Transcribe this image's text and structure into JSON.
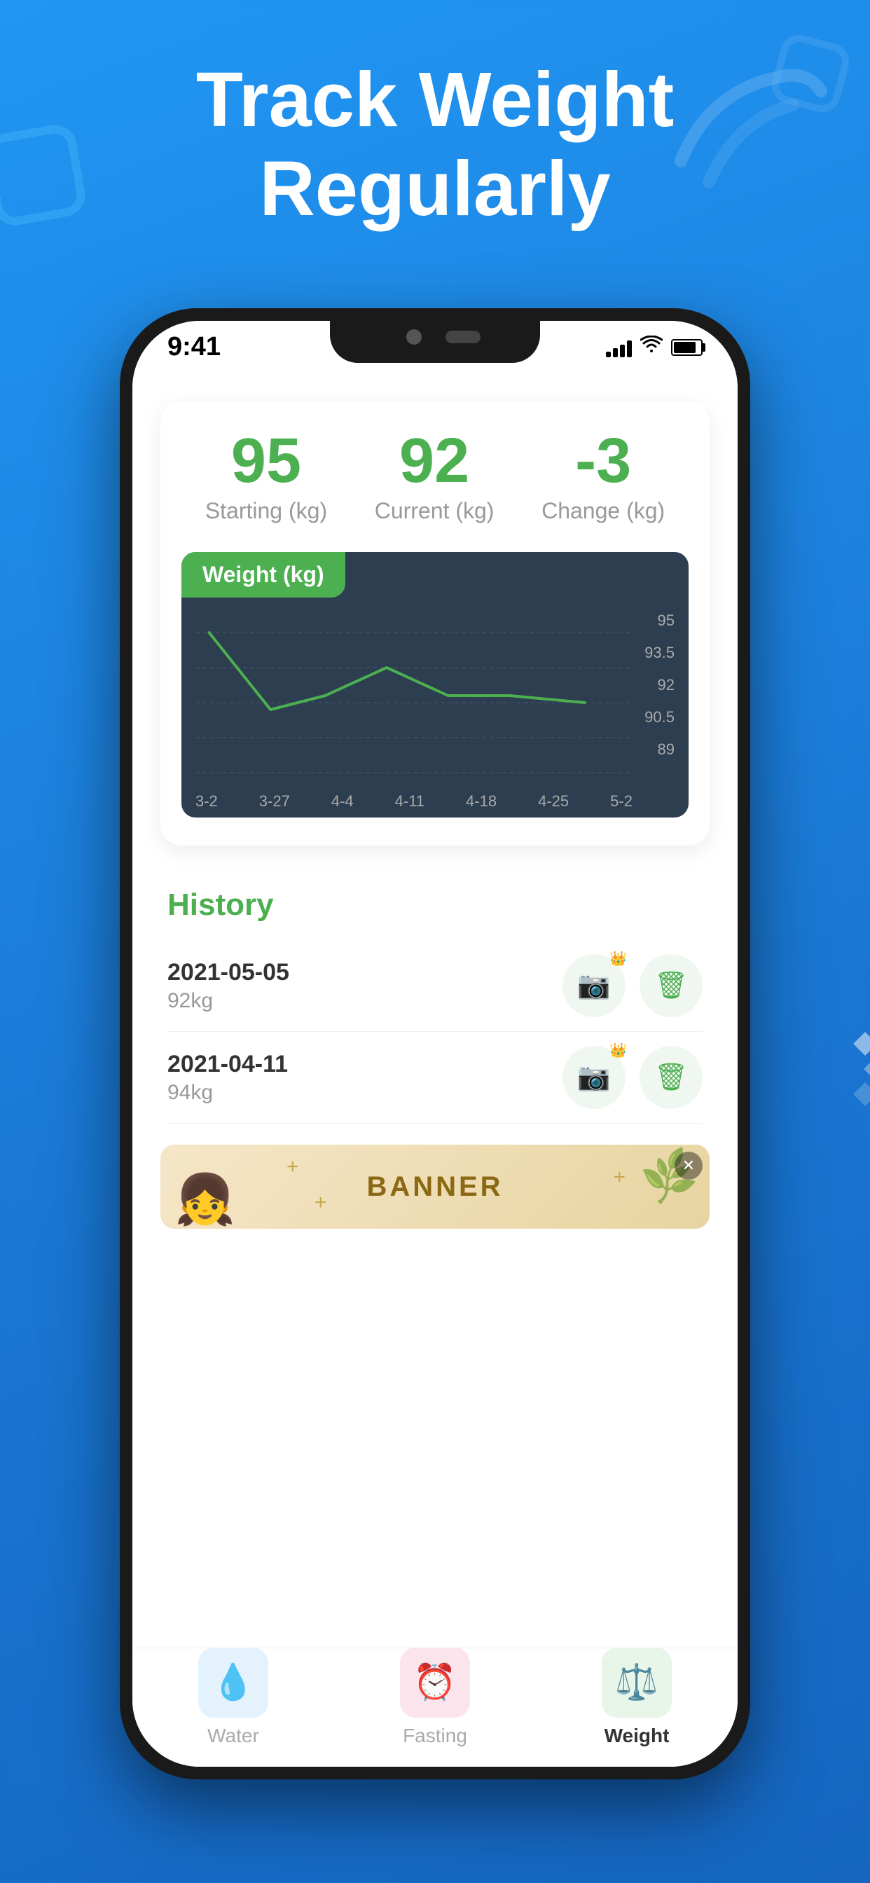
{
  "hero": {
    "title_line1": "Track Weight",
    "title_line2": "Regularly"
  },
  "status_bar": {
    "time": "9:41"
  },
  "stats": {
    "starting_value": "95",
    "starting_label": "Starting (kg)",
    "current_value": "92",
    "current_label": "Current (kg)",
    "change_value": "-3",
    "change_label": "Change (kg)"
  },
  "chart": {
    "title": "Weight",
    "unit": "(kg)",
    "y_labels": [
      "95",
      "93.5",
      "92",
      "90.5",
      "89"
    ],
    "x_labels": [
      "3-2",
      "3-27",
      "4-4",
      "4-11",
      "4-18",
      "4-25",
      "5-2"
    ]
  },
  "history": {
    "title": "History",
    "items": [
      {
        "date": "2021-05-05",
        "weight": "92kg"
      },
      {
        "date": "2021-04-11",
        "weight": "94kg"
      }
    ]
  },
  "banner": {
    "text": "BANNER"
  },
  "tabs": [
    {
      "id": "water",
      "label": "Water",
      "active": false
    },
    {
      "id": "fasting",
      "label": "Fasting",
      "active": false
    },
    {
      "id": "weight",
      "label": "Weight",
      "active": true
    }
  ]
}
